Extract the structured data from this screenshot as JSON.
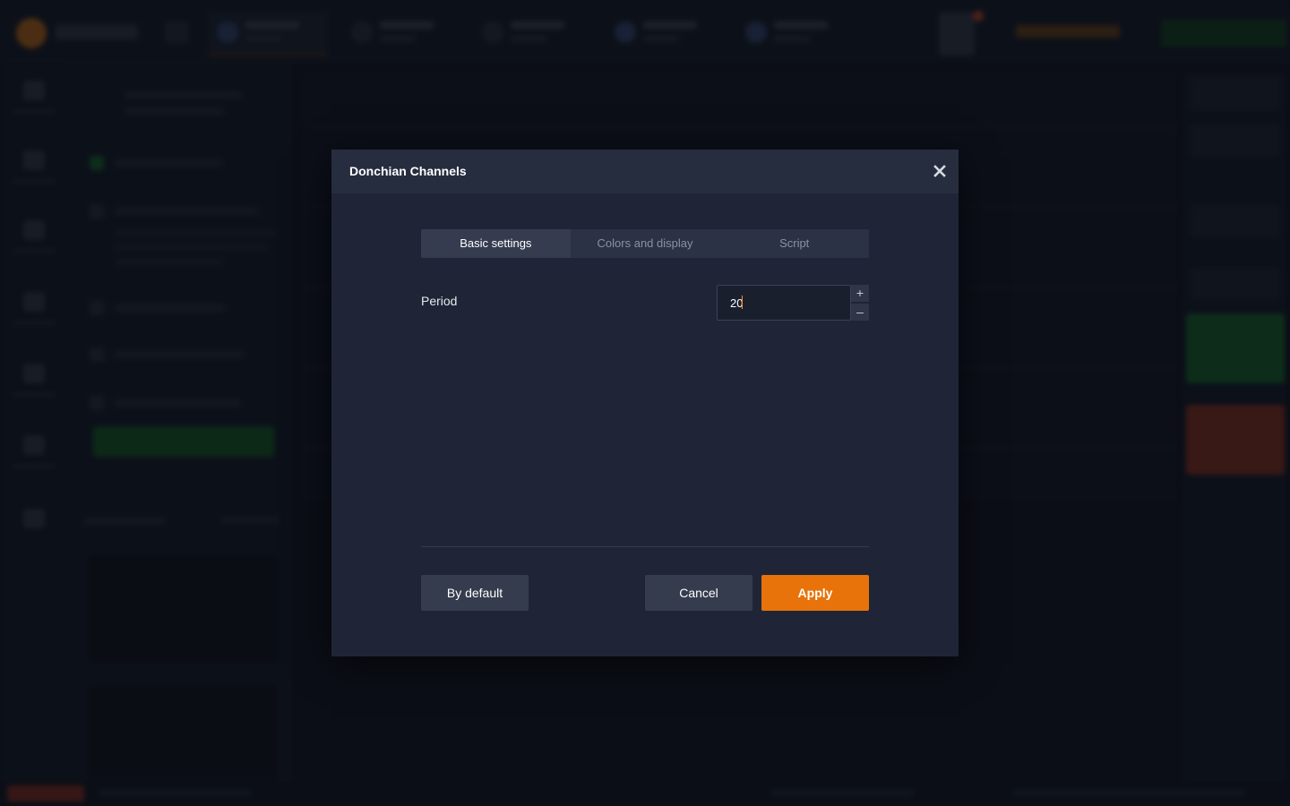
{
  "dialog": {
    "title": "Donchian Channels",
    "close_icon": "close-icon",
    "tabs": [
      {
        "label": "Basic settings",
        "active": true
      },
      {
        "label": "Colors and display",
        "active": false
      },
      {
        "label": "Script",
        "active": false
      }
    ],
    "fields": {
      "period": {
        "label": "Period",
        "value": "20",
        "increment_symbol": "+",
        "decrement_symbol": "–"
      }
    },
    "buttons": {
      "by_default": "By default",
      "cancel": "Cancel",
      "apply": "Apply"
    }
  },
  "colors": {
    "accent": "#e8730a",
    "dialog_bg": "#1f2536",
    "header_bg": "#262d3f",
    "buy": "#16782a",
    "sell": "#a8361d"
  }
}
